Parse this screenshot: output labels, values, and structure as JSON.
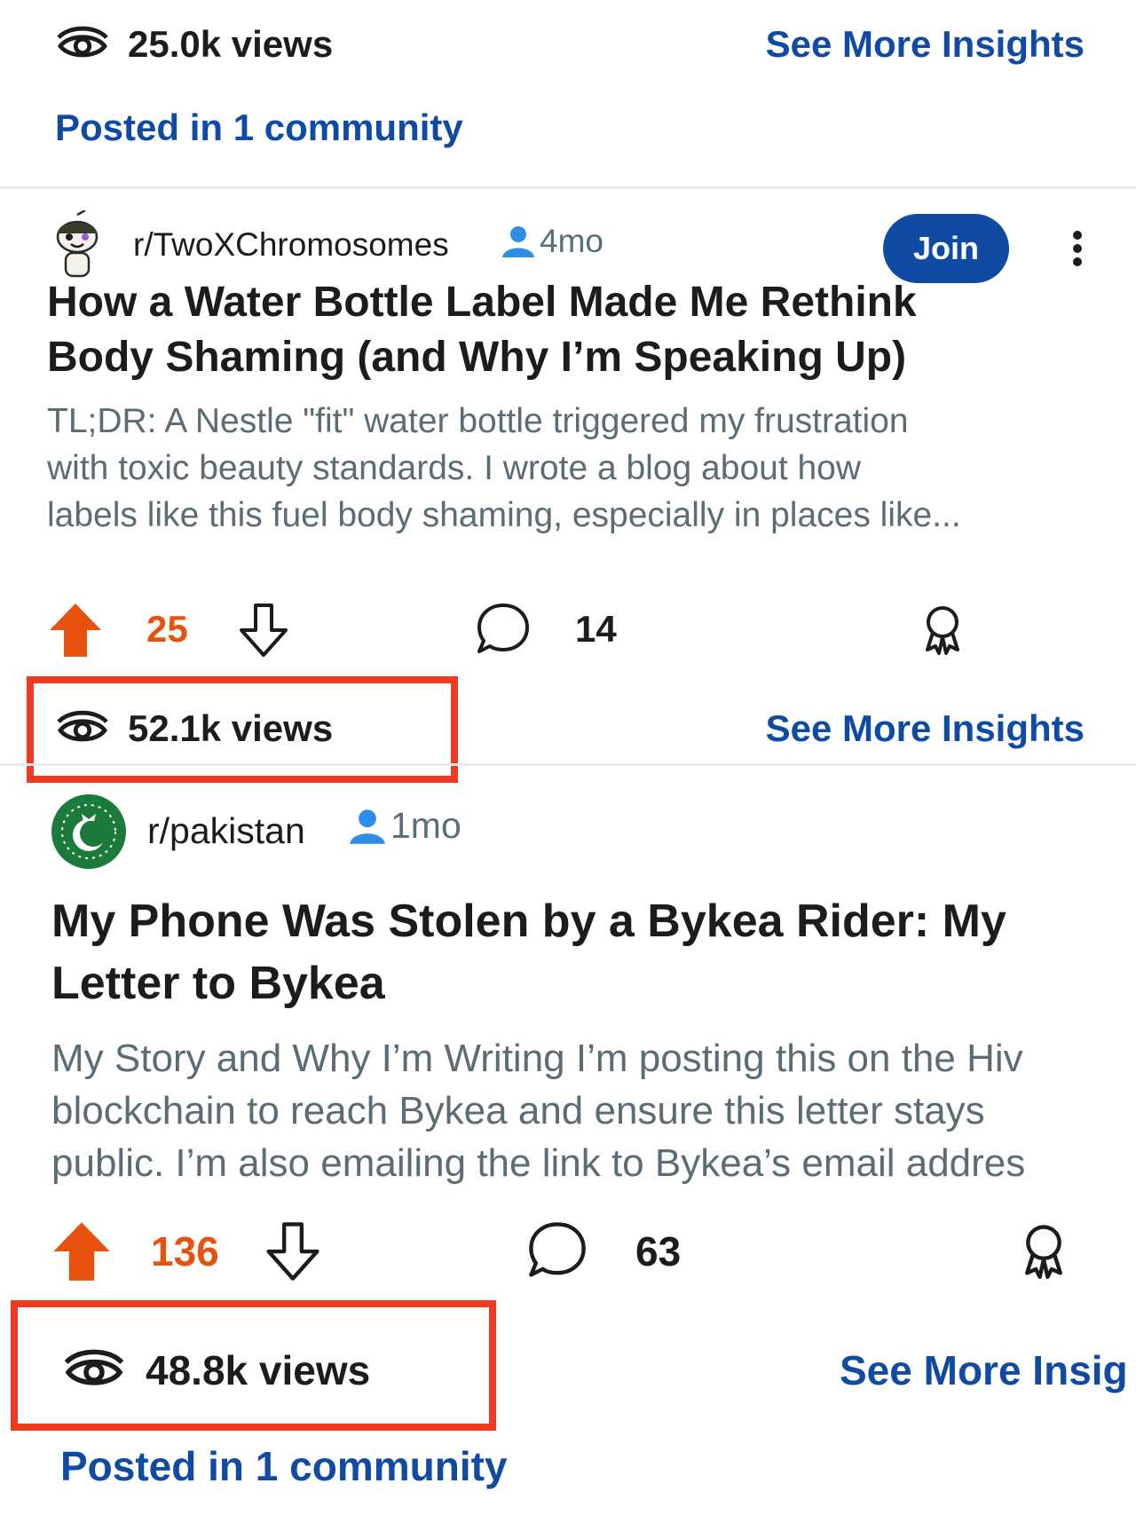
{
  "top_post": {
    "views": "25.0k views",
    "insights_link": "See More Insights",
    "posted_in": "Posted in 1 community"
  },
  "post1": {
    "subreddit": "r/TwoXChromosomes",
    "age": "4mo",
    "join_label": "Join",
    "title_line1": "How a Water Bottle Label Made Me Rethink",
    "title_line2": "Body Shaming (and Why I’m Speaking Up)",
    "body_line1": "TL;DR: A Nestle \"fit\" water bottle triggered my frustration",
    "body_line2": "with toxic beauty standards. I wrote a blog about how",
    "body_line3": "labels like this fuel body shaming, especially in places like...",
    "score": "25",
    "comments": "14",
    "views": "52.1k views",
    "insights_link": "See More Insights"
  },
  "post2": {
    "subreddit": "r/pakistan",
    "age": "1mo",
    "title_line1": "My Phone Was Stolen by a Bykea Rider: My",
    "title_line2": "Letter to Bykea",
    "body_line1": "My Story and Why I’m Writing I’m posting this on the Hiv",
    "body_line2": "blockchain to reach Bykea and ensure this letter stays",
    "body_line3": "public. I’m also emailing the link to Bykea’s email addres",
    "score": "136",
    "comments": "63",
    "views": "48.8k views",
    "insights_link": "See More Insig",
    "posted_in": "Posted in 1 community"
  },
  "colors": {
    "upvote": "#e8520f",
    "link": "#0f4aa3",
    "highlight_box": "#ee3a1f"
  },
  "icons": [
    "eye-icon",
    "user-icon",
    "kebab-menu-icon",
    "upvote-icon",
    "downvote-icon",
    "comment-icon",
    "award-icon",
    "snoo-avatar",
    "pakistan-avatar"
  ]
}
